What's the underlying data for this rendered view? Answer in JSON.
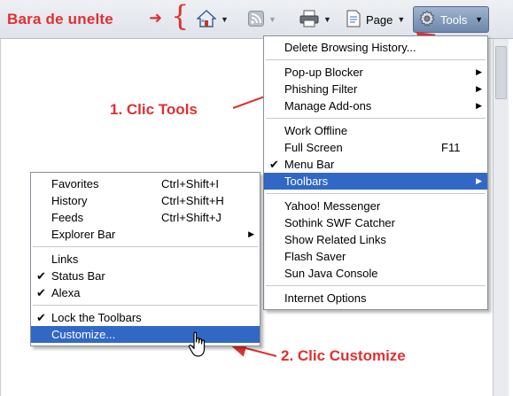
{
  "annotations": {
    "toolbar_label": "Bara de unelte",
    "step1": "1. Clic Tools",
    "step2": "2. Clic Customize"
  },
  "toolbar": {
    "home_icon": "home-icon",
    "feeds_icon": "rss-feed-icon",
    "print_icon": "printer-icon",
    "page_label": "Page",
    "tools_label": "Tools"
  },
  "tools_menu": {
    "items": [
      {
        "label": "Delete Browsing History..."
      },
      {
        "label": "Pop-up Blocker"
      },
      {
        "label": "Phishing Filter"
      },
      {
        "label": "Manage Add-ons"
      },
      {
        "label": "Work Offline"
      },
      {
        "label": "Full Screen",
        "shortcut": "F11"
      },
      {
        "label": "Menu Bar"
      },
      {
        "label": "Toolbars"
      },
      {
        "label": "Yahoo! Messenger"
      },
      {
        "label": "Sothink SWF Catcher"
      },
      {
        "label": "Show Related Links"
      },
      {
        "label": "Flash Saver"
      },
      {
        "label": "Sun Java Console"
      },
      {
        "label": "Internet Options"
      }
    ]
  },
  "toolbars_menu": {
    "items": [
      {
        "label": "Favorites",
        "shortcut": "Ctrl+Shift+I"
      },
      {
        "label": "History",
        "shortcut": "Ctrl+Shift+H"
      },
      {
        "label": "Feeds",
        "shortcut": "Ctrl+Shift+J"
      },
      {
        "label": "Explorer Bar"
      },
      {
        "label": "Links"
      },
      {
        "label": "Status Bar"
      },
      {
        "label": "Alexa"
      },
      {
        "label": "Lock the Toolbars"
      },
      {
        "label": "Customize..."
      }
    ]
  },
  "colors": {
    "annotation_red": "#e03030",
    "highlight_blue": "#3168c6",
    "tools_button": "#6d87ab"
  }
}
